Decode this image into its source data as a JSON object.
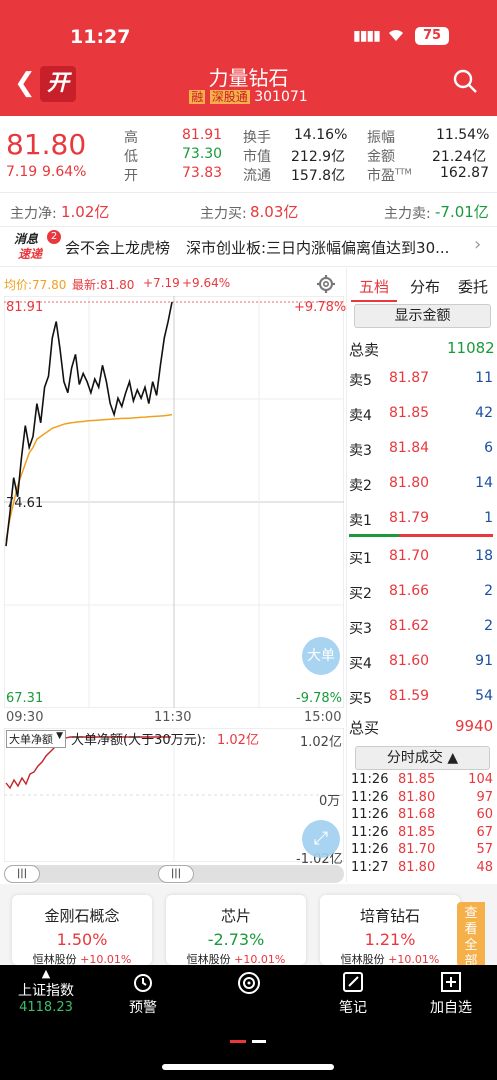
{
  "status": {
    "time": "11:27",
    "battery": "75"
  },
  "header": {
    "badge": "开",
    "title": "力量钻石",
    "tag1": "融",
    "tag2": "深股通",
    "code": "301071"
  },
  "quote": {
    "price": "81.80",
    "change": "7.19",
    "change_pct": "9.64%",
    "high_label": "高",
    "high": "81.91",
    "low_label": "低",
    "low": "73.30",
    "open_label": "开",
    "open": "73.83",
    "turnover_label": "换手",
    "turnover": "14.16%",
    "mktcap_label": "市值",
    "mktcap": "212.9亿",
    "float_label": "流通",
    "float": "157.8亿",
    "amplitude_label": "振幅",
    "amplitude": "11.54%",
    "amount_label": "金额",
    "amount": "21.24亿",
    "pe_label": "市盈",
    "pe_sup": "TTM",
    "pe": "162.87"
  },
  "flows": {
    "net_label": "主力净:",
    "net": "1.02亿",
    "buy_label": "主力买:",
    "buy": "8.03亿",
    "sell_label": "主力卖:",
    "sell": "-7.01亿"
  },
  "news": {
    "line1": "消息",
    "line2": "速递",
    "count": "2",
    "item1": "会不会上龙虎榜",
    "item2": "深市创业板:三日内涨幅偏离值达到30..."
  },
  "chart_header": {
    "avg": "均价:77.80",
    "latest": "最新:81.80",
    "chg": "+7.19",
    "pct": "+9.64%"
  },
  "chart_labels": {
    "top_price": "81.91",
    "top_pct": "+9.78%",
    "mid_price": "74.61",
    "bottom_price": "67.31",
    "bottom_pct": "-9.78%",
    "t_start": "09:30",
    "t_mid": "11:30",
    "t_end": "15:00",
    "big_btn": "大单"
  },
  "sub_chart": {
    "dropdown": "大单净额",
    "title": "大单净额(大于30万元):",
    "value": "1.02亿",
    "top": "1.02亿",
    "zero": "0万",
    "bottom": "-1.02亿"
  },
  "tabs": [
    "五档",
    "分布",
    "委托"
  ],
  "orderbook": {
    "show_amount": "显示金额",
    "total_sell_label": "总卖",
    "total_sell": "11082",
    "sells": [
      {
        "label": "卖5",
        "price": "81.87",
        "vol": "11"
      },
      {
        "label": "卖4",
        "price": "81.85",
        "vol": "42"
      },
      {
        "label": "卖3",
        "price": "81.84",
        "vol": "6"
      },
      {
        "label": "卖2",
        "price": "81.80",
        "vol": "14"
      },
      {
        "label": "卖1",
        "price": "81.79",
        "vol": "1"
      }
    ],
    "buys": [
      {
        "label": "买1",
        "price": "81.70",
        "vol": "18"
      },
      {
        "label": "买2",
        "price": "81.66",
        "vol": "2"
      },
      {
        "label": "买3",
        "price": "81.62",
        "vol": "2"
      },
      {
        "label": "买4",
        "price": "81.60",
        "vol": "91"
      },
      {
        "label": "买5",
        "price": "81.59",
        "vol": "54"
      }
    ],
    "total_buy_label": "总买",
    "total_buy": "9940",
    "ticks_btn": "分时成交",
    "ticks": [
      {
        "t": "11:26",
        "p": "81.85",
        "v": "104"
      },
      {
        "t": "11:26",
        "p": "81.80",
        "v": "97"
      },
      {
        "t": "11:26",
        "p": "81.68",
        "v": "60"
      },
      {
        "t": "11:26",
        "p": "81.85",
        "v": "67"
      },
      {
        "t": "11:26",
        "p": "81.70",
        "v": "57"
      },
      {
        "t": "11:27",
        "p": "81.80",
        "v": "48"
      }
    ]
  },
  "concepts": [
    {
      "name": "金刚石概念",
      "pct": "1.50%",
      "lead": "恒林股份",
      "lead_pct": "+10.01%"
    },
    {
      "name": "芯片",
      "pct": "-2.73%",
      "lead": "恒林股份",
      "lead_pct": "+10.01%"
    },
    {
      "name": "培育钻石",
      "pct": "1.21%",
      "lead": "恒林股份",
      "lead_pct": "+10.01%"
    }
  ],
  "view_all": "查看全部",
  "bottom_nav": {
    "index_name": "上证指数",
    "index_value": "4118.23",
    "alert": "预警",
    "notes": "笔记",
    "add": "加自选"
  },
  "colors": {
    "up": "#e8383d",
    "down": "#1a9a3a",
    "avg_line": "#f0a020",
    "header": "#e8383d"
  },
  "chart_data": {
    "type": "line",
    "y_range": [
      67.31,
      81.91
    ],
    "price": [
      73.0,
      74.2,
      75.5,
      74.8,
      76.2,
      77.4,
      76.6,
      77.0,
      78.2,
      77.5,
      78.8,
      79.2,
      80.6,
      81.2,
      80.2,
      79.0,
      78.6,
      79.5,
      80.0,
      78.9,
      79.3,
      79.0,
      78.6,
      79.1,
      78.8,
      79.6,
      79.0,
      78.2,
      77.8,
      78.4,
      78.1,
      78.6,
      79.0,
      78.3,
      78.7,
      78.4,
      78.8,
      78.2,
      79.0,
      78.5,
      79.6,
      80.6,
      81.2,
      81.91
    ],
    "avg": [
      73.2,
      74.0,
      74.6,
      75.2,
      75.6,
      76.0,
      76.4,
      76.6,
      76.9,
      77.0,
      77.1,
      77.2,
      77.3,
      77.35,
      77.4,
      77.45,
      77.48,
      77.5,
      77.52,
      77.54,
      77.55,
      77.57,
      77.58,
      77.59,
      77.6,
      77.61,
      77.62,
      77.63,
      77.64,
      77.65,
      77.66,
      77.66,
      77.67,
      77.68,
      77.69,
      77.7,
      77.71,
      77.72,
      77.73,
      77.74,
      77.75,
      77.76,
      77.78,
      77.8
    ]
  }
}
